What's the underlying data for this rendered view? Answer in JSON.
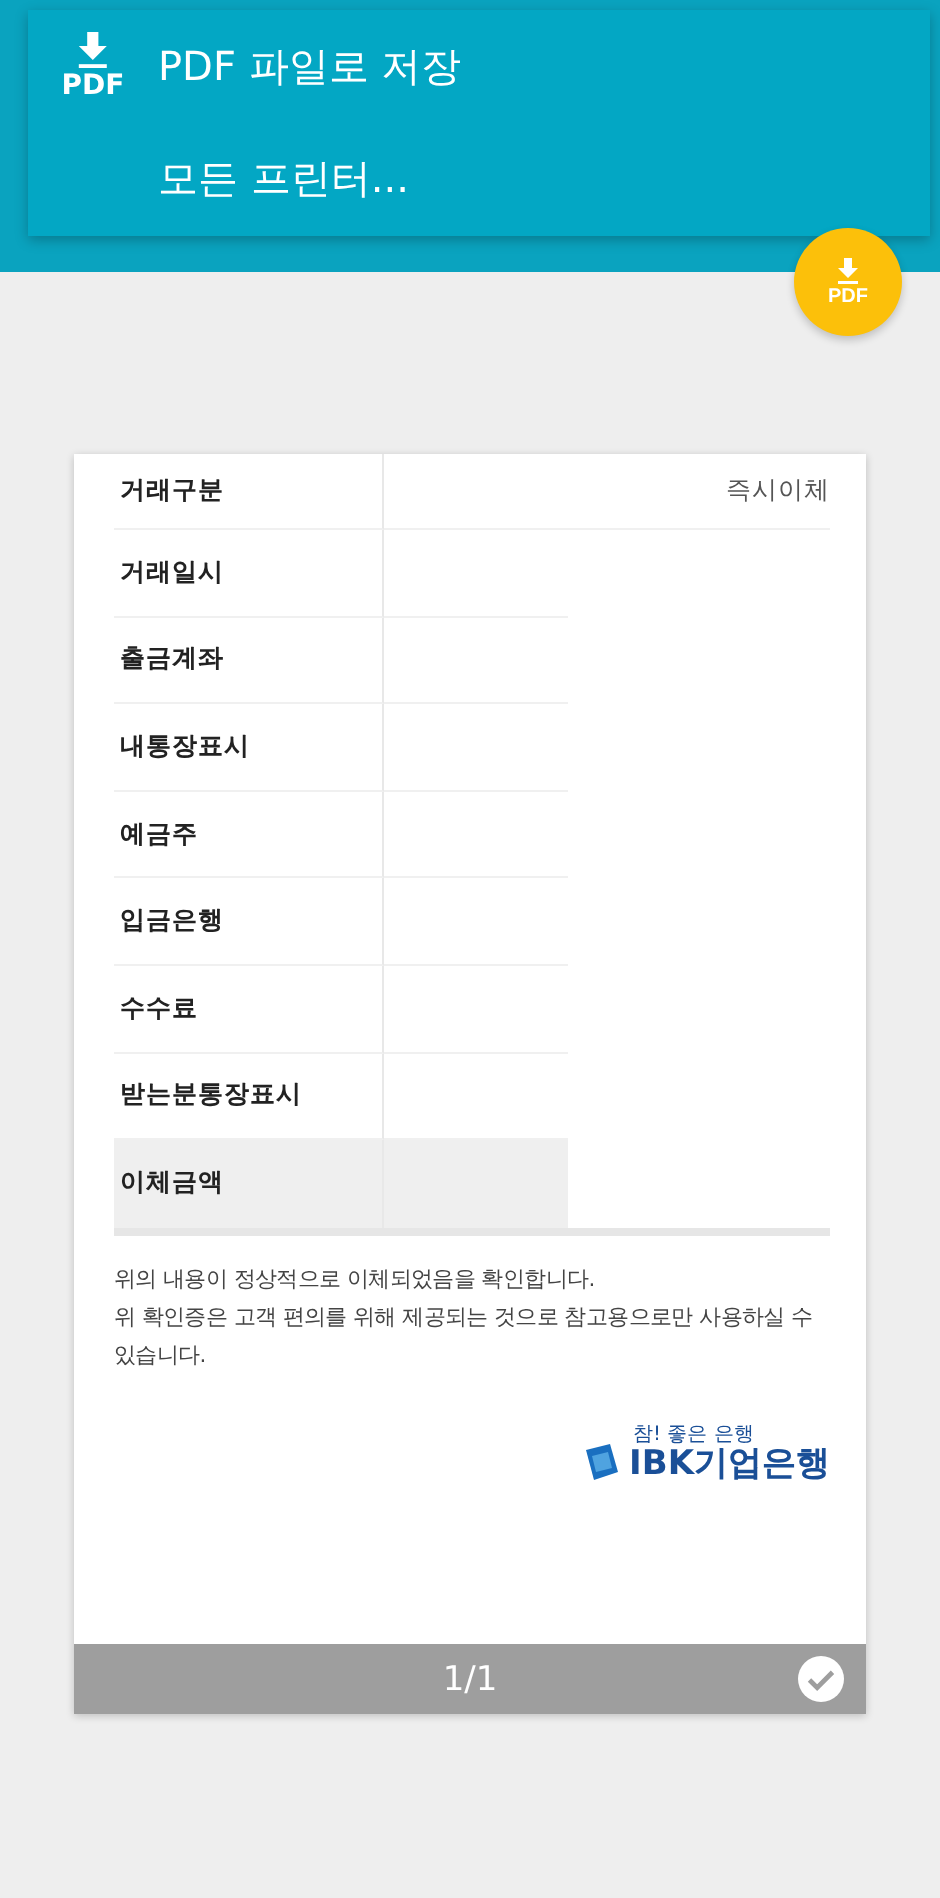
{
  "print_menu": {
    "items": [
      {
        "kind": "pdf",
        "label": "PDF 파일로 저장",
        "icon_text": "PDF"
      },
      {
        "kind": "printer",
        "label": "모든 프린터..."
      }
    ]
  },
  "fab": {
    "icon_text": "PDF"
  },
  "receipt": {
    "rows": [
      {
        "label": "거래구분",
        "value": "즉시이체",
        "shaded": false
      },
      {
        "label": "거래일시",
        "shaded": false
      },
      {
        "label": "출금계좌",
        "shaded": false
      },
      {
        "label": "내통장표시",
        "shaded": false
      },
      {
        "label": "예금주",
        "shaded": false
      },
      {
        "label": "입금은행",
        "shaded": false
      },
      {
        "label": "수수료",
        "shaded": false
      },
      {
        "label": "받는분통장표시",
        "shaded": false
      },
      {
        "label": "이체금액",
        "shaded": true
      }
    ],
    "notice": [
      "위의 내용이 정상적으로 이체되었음을 확인합니다.",
      "위 확인증은 고객 편의를 위해 제공되는 것으로 참고용으로만 사용하실 수 있습니다."
    ],
    "logo": {
      "tagline": "참! 좋은 은행",
      "name": "IBK기업은행"
    }
  },
  "page_bar": {
    "page": "1/1",
    "selected": true
  }
}
